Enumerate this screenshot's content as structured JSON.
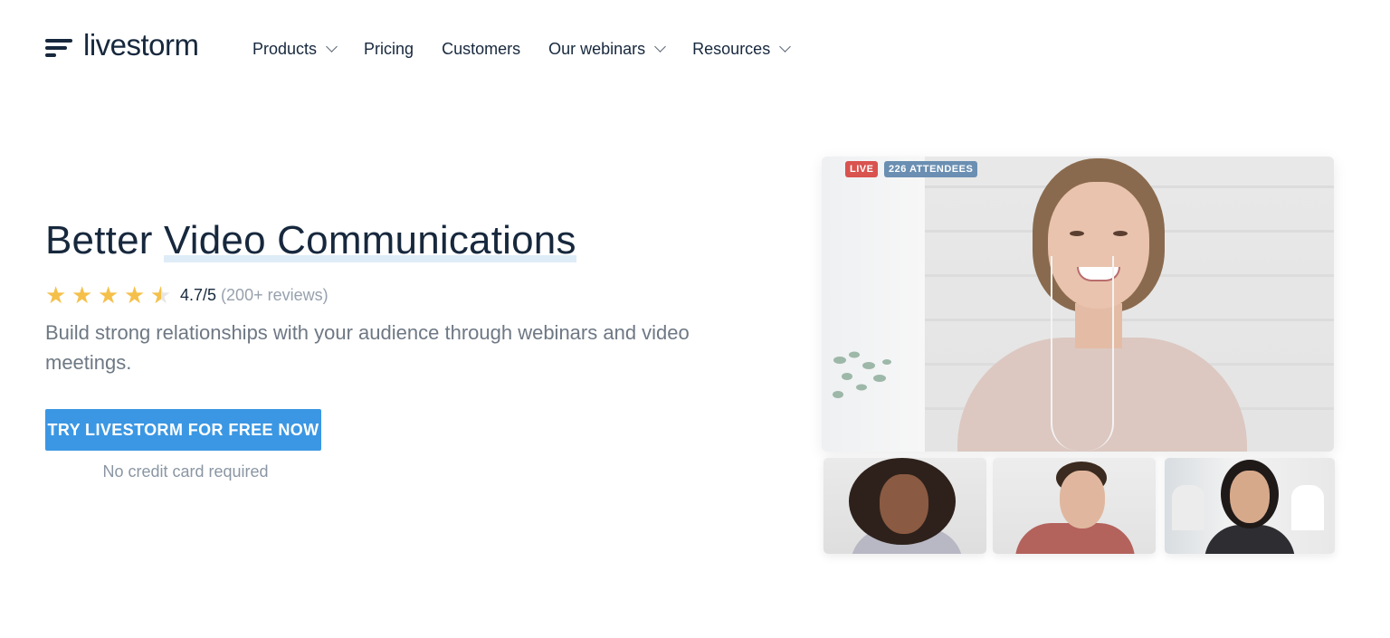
{
  "nav": {
    "logo_text": "livestorm",
    "items": [
      {
        "label": "Products",
        "dropdown": true
      },
      {
        "label": "Pricing",
        "dropdown": false
      },
      {
        "label": "Customers",
        "dropdown": false
      },
      {
        "label": "Our webinars",
        "dropdown": true
      },
      {
        "label": "Resources",
        "dropdown": true
      }
    ]
  },
  "hero": {
    "title_part1": "Better ",
    "title_highlight": "Video Communications",
    "rating_value": "4.7/5",
    "rating_count": "(200+ reviews)",
    "stars": 4.5,
    "subtitle": "Build strong relationships with your audience through webinars and video meetings.",
    "cta_label": "TRY LIVESTORM FOR FREE NOW",
    "cta_note": "No credit card required"
  },
  "video": {
    "live_badge": "LIVE",
    "attendees_badge": "226 ATTENDEES"
  },
  "colors": {
    "brand_dark": "#17283d",
    "cta_blue": "#3b97e3",
    "star_gold": "#f5c04a",
    "live_red": "#d9534f"
  }
}
